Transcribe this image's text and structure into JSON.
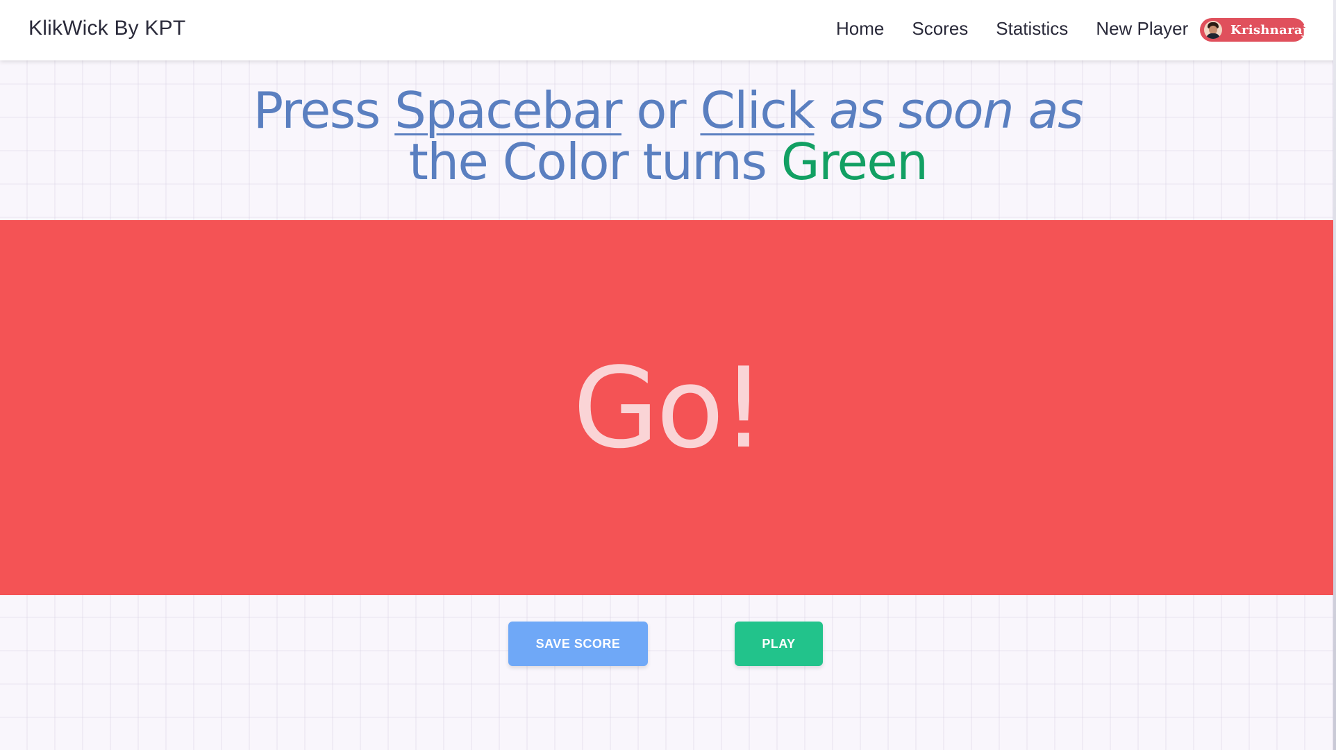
{
  "navbar": {
    "brand": "KlikWick By KPT",
    "links": [
      "Home",
      "Scores",
      "Statistics",
      "New Player"
    ],
    "user": {
      "name": "Krishnaraj",
      "badge_color": "#e0505c"
    }
  },
  "headline": {
    "press": "Press",
    "spacebar": "Spacebar",
    "or": "or",
    "click": "Click",
    "as_soon_as": "as soon as",
    "the_color_turns": "the Color turns",
    "green": "Green"
  },
  "game": {
    "status_text": "Go!",
    "background_color": "#f45355"
  },
  "actions": {
    "save_score": "SAVE SCORE",
    "play": "PLAY"
  },
  "colors": {
    "headline": "#5a7fc0",
    "green": "#12a063",
    "save_button": "#6fa8f7",
    "play_button": "#22c38b"
  }
}
